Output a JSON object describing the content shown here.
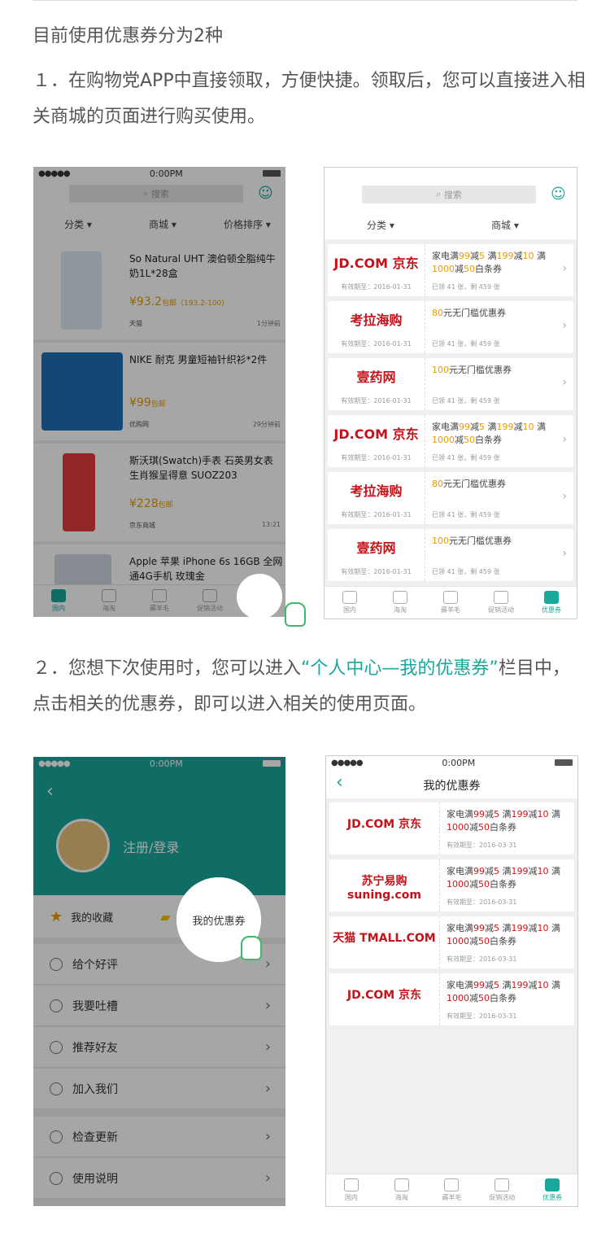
{
  "intro": "目前使用优惠券分为2种",
  "step1": "１．在购物党APP中直接领取，方便快捷。领取后，您可以直接进入相关商城的页面进行购买使用。",
  "step2_before": "２．您想下次使用时，您可以进入",
  "step2_highlight": "“个人中心—我的优惠券”",
  "step2_after": "栏目中，点击相关的优惠券，即可以进入相关的使用页面。",
  "status": {
    "dots": "●●●●●",
    "time": "0:00PM"
  },
  "search": {
    "placeholder": "搜索"
  },
  "filters1": [
    "分类 ▾",
    "商城 ▾",
    "价格排序 ▾"
  ],
  "filters2": [
    "分类 ▾",
    "商城 ▾"
  ],
  "products": [
    {
      "title": "So Natural UHT 澳伯顿全脂纯牛奶1L*28盒",
      "price": "¥93.2",
      "price_note": "包邮（193.2-100）",
      "shop": "天猫",
      "time": "1分钟前"
    },
    {
      "title": "NIKE 耐克 男童短袖针织衫*2件",
      "price": "¥99",
      "price_note": "包邮",
      "shop": "优购网",
      "time": "29分钟前"
    },
    {
      "title": "斯沃琪(Swatch)手表 石英男女表 生肖猴呈得意 SUOZ203",
      "price": "¥228",
      "price_note": "包邮",
      "shop": "京东商城",
      "time": "13:21"
    },
    {
      "title": "Apple 苹果 iPhone 6s 16GB 全网通4G手机 玫瑰金",
      "price": "",
      "price_note": "",
      "shop": "",
      "time": ""
    }
  ],
  "tabs": [
    "国内",
    "海淘",
    "薅羊毛",
    "促销活动",
    "优惠券"
  ],
  "coupons": [
    {
      "logo": "JD.COM 京东",
      "l1a": "家电满",
      "l1b": "99",
      "l1c": "减",
      "l1d": "5",
      "l1e": " 满",
      "l1f": "199",
      "l1g": "减",
      "l1h": "10",
      "l1i": " 满",
      "l2a": "1000",
      "l2b": "减",
      "l2c": "50",
      "l2d": "白条券",
      "expire": "有效期至：2016-01-31",
      "sub": "已领 41 张，剩 459 张"
    },
    {
      "logo": "考拉海购",
      "l1a": "",
      "l1b": "80",
      "l1c": "元无门槛优惠券",
      "l1d": "",
      "l1e": "",
      "l1f": "",
      "l1g": "",
      "l1h": "",
      "l1i": "",
      "l2a": "",
      "l2b": "",
      "l2c": "",
      "l2d": "",
      "expire": "有效期至：2016-01-31",
      "sub": "已领 41 张，剩 459 张"
    },
    {
      "logo": "壹药网",
      "l1a": "",
      "l1b": "100",
      "l1c": "元无门槛优惠券",
      "l1d": "",
      "l1e": "",
      "l1f": "",
      "l1g": "",
      "l1h": "",
      "l1i": "",
      "l2a": "",
      "l2b": "",
      "l2c": "",
      "l2d": "",
      "expire": "有效期至：2016-01-31",
      "sub": "已领 41 张，剩 459 张"
    },
    {
      "logo": "JD.COM 京东",
      "l1a": "家电满",
      "l1b": "99",
      "l1c": "减",
      "l1d": "5",
      "l1e": " 满",
      "l1f": "199",
      "l1g": "减",
      "l1h": "10",
      "l1i": " 满",
      "l2a": "1000",
      "l2b": "减",
      "l2c": "50",
      "l2d": "白条券",
      "expire": "有效期至：2016-01-31",
      "sub": "已领 41 张，剩 459 张"
    },
    {
      "logo": "考拉海购",
      "l1a": "",
      "l1b": "80",
      "l1c": "元无门槛优惠券",
      "l1d": "",
      "l1e": "",
      "l1f": "",
      "l1g": "",
      "l1h": "",
      "l1i": "",
      "l2a": "",
      "l2b": "",
      "l2c": "",
      "l2d": "",
      "expire": "有效期至：2016-01-31",
      "sub": "已领 41 张，剩 459 张"
    },
    {
      "logo": "壹药网",
      "l1a": "",
      "l1b": "100",
      "l1c": "元无门槛优惠券",
      "l1d": "",
      "l1e": "",
      "l1f": "",
      "l1g": "",
      "l1h": "",
      "l1i": "",
      "l2a": "",
      "l2b": "",
      "l2c": "",
      "l2d": "",
      "expire": "有效期至：2016-01-31",
      "sub": "已领 41 张，剩 459 张"
    }
  ],
  "profile": {
    "login": "注册/登录",
    "fav": "我的收藏",
    "mycoupon": "我的优惠券"
  },
  "menu": [
    "给个好评",
    "我要吐槽",
    "推荐好友",
    "加入我们",
    "检查更新",
    "使用说明"
  ],
  "mycoupons": {
    "title": "我的优惠券",
    "items": [
      {
        "logo": "JD.COM 京东",
        "expire": "有效期至：2016-03-31"
      },
      {
        "logo": "苏宁易购 suning.com",
        "expire": "有效期至：2016-03-31"
      },
      {
        "logo": "天猫 TMALL.COM",
        "expire": "有效期至：2016-03-31"
      },
      {
        "logo": "JD.COM 京东",
        "expire": "有效期至：2016-03-31"
      }
    ],
    "l1a": "家电满",
    "l1b": "99",
    "l1c": "减",
    "l1d": "5",
    "l1e": " 满",
    "l1f": "199",
    "l1g": "减",
    "l1h": "10",
    "l1i": " 满",
    "l2a": "1000",
    "l2b": "减",
    "l2c": "50",
    "l2d": "白条券"
  },
  "colors": {
    "accent": "#1aa89c",
    "price": "#e89b00",
    "red": "#d4141b"
  }
}
